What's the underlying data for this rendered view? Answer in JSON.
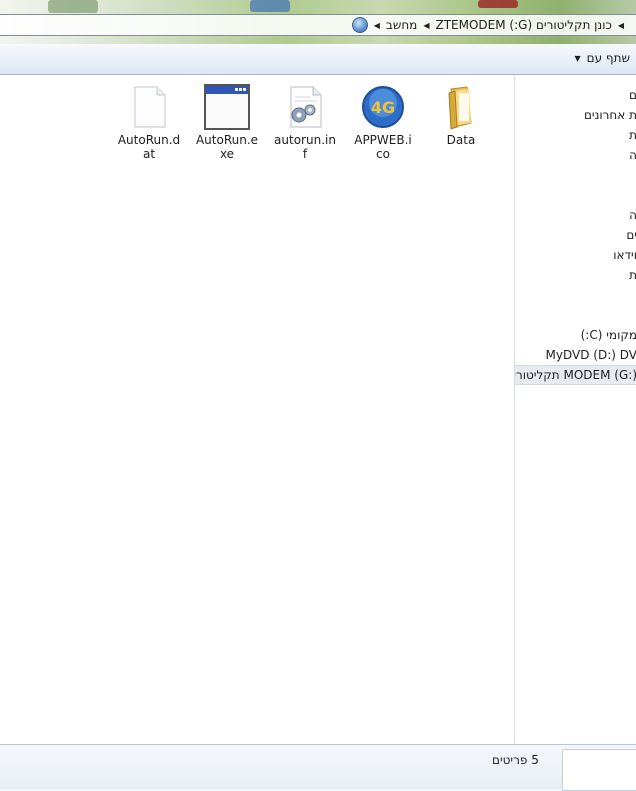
{
  "address": {
    "crumbs": [
      "מחשב",
      "כונן תקליטורים (G:) ZTEMODEM"
    ]
  },
  "toolbar": {
    "share_label": "שתף עם"
  },
  "navigation": {
    "items": [
      {
        "label": "ם"
      },
      {
        "label": "ת אחרונים"
      },
      {
        "label": "ת"
      },
      {
        "label": "ה"
      },
      {
        "label": "ה"
      },
      {
        "label": "ים"
      },
      {
        "label": "וידאו"
      },
      {
        "label": "ת"
      },
      {
        "label": "מקומי (C:)"
      },
      {
        "label": "MyDVD (D:) DV"
      },
      {
        "label": "MODEM (G:) תקליטורים"
      }
    ]
  },
  "files": [
    {
      "name": "Data",
      "icon": "folder-icon"
    },
    {
      "name": "APPWEB.ico",
      "icon": "4g-icon"
    },
    {
      "name": "autorun.inf",
      "icon": "settings-file-icon"
    },
    {
      "name": "AutoRun.exe",
      "icon": "application-icon"
    },
    {
      "name": "AutoRun.dat",
      "icon": "blank-file-icon"
    }
  ],
  "status": {
    "item_count": "5 פריטים"
  }
}
